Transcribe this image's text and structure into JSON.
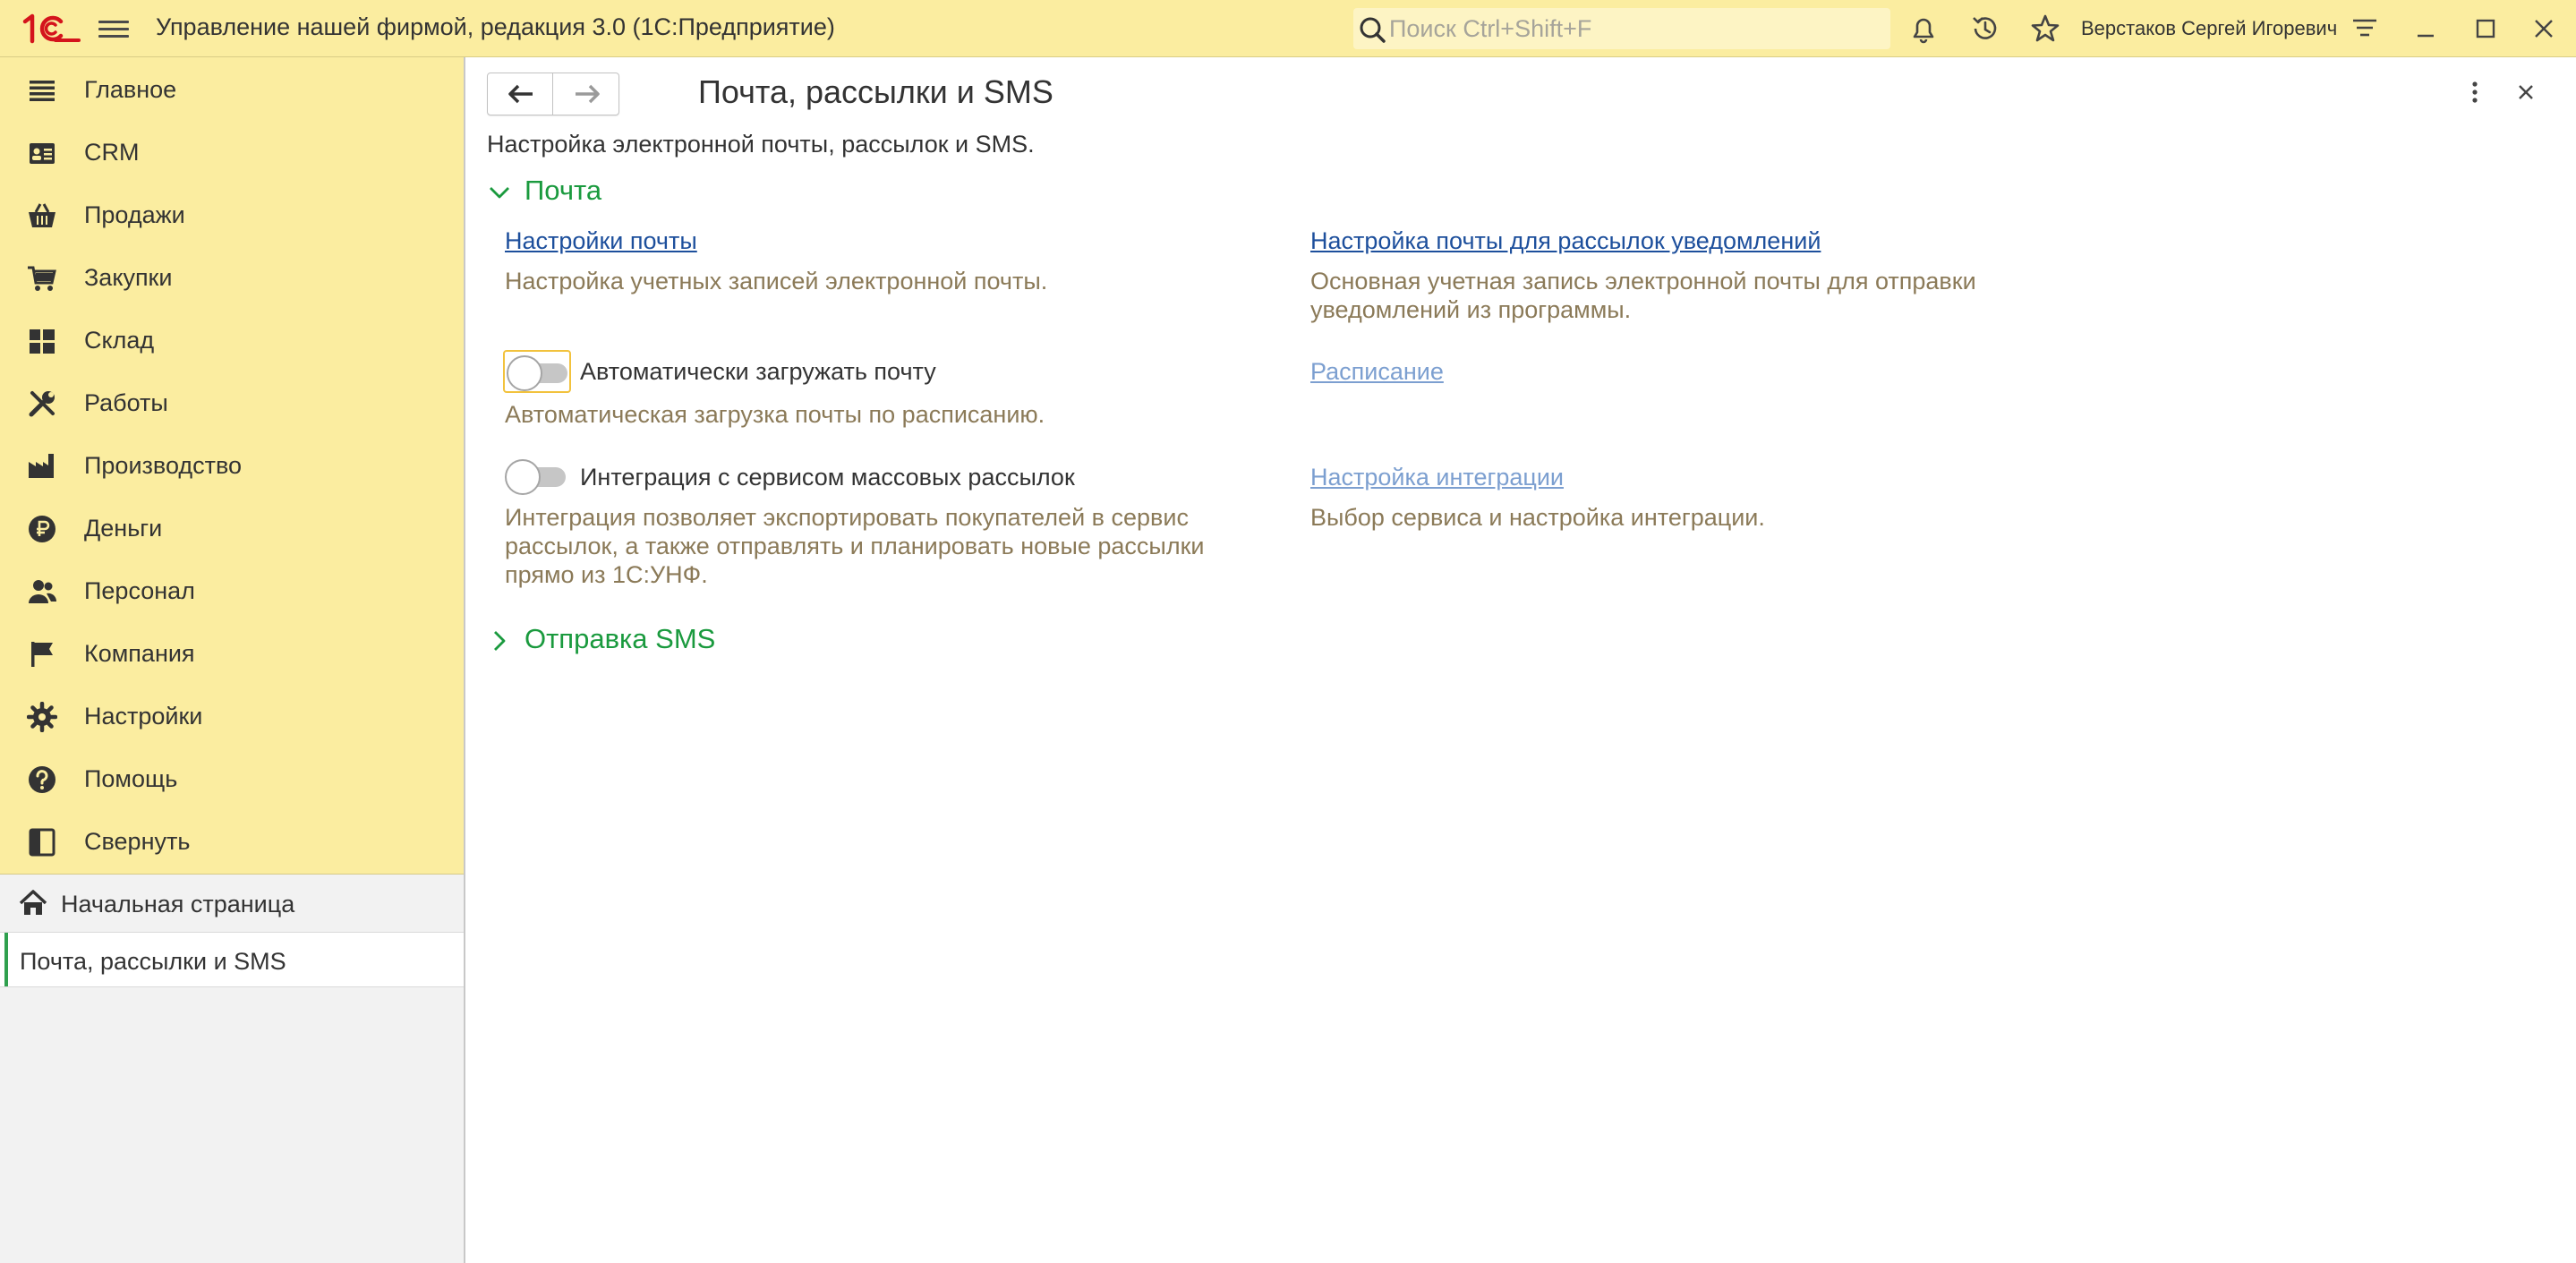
{
  "app": {
    "title": "Управление нашей фирмой, редакция 3.0  (1С:Предприятие)",
    "logo_icon": "1c-logo",
    "brand_color": "#d4141c"
  },
  "search": {
    "placeholder": "Поиск Ctrl+Shift+F"
  },
  "user": {
    "name": "Верстаков Сергей Игоревич"
  },
  "titlebar_icons": [
    "search-icon",
    "bell-icon",
    "history-icon",
    "star-icon",
    "settings-menu-icon",
    "minimize-icon",
    "maximize-icon",
    "close-icon"
  ],
  "sidebar": {
    "sections": [
      {
        "label": "Главное",
        "icon": "main-icon"
      },
      {
        "label": "CRM",
        "icon": "crm-icon"
      },
      {
        "label": "Продажи",
        "icon": "basket-icon"
      },
      {
        "label": "Закупки",
        "icon": "cart-icon"
      },
      {
        "label": "Склад",
        "icon": "warehouse-icon"
      },
      {
        "label": "Работы",
        "icon": "tools-icon"
      },
      {
        "label": "Производство",
        "icon": "factory-icon"
      },
      {
        "label": "Деньги",
        "icon": "ruble-icon"
      },
      {
        "label": "Персонал",
        "icon": "people-icon"
      },
      {
        "label": "Компания",
        "icon": "flag-icon"
      },
      {
        "label": "Настройки",
        "icon": "gear-icon"
      },
      {
        "label": "Помощь",
        "icon": "help-icon"
      },
      {
        "label": "Свернуть",
        "icon": "collapse-panel-icon"
      }
    ],
    "open_windows": [
      {
        "label": "Начальная страница",
        "icon": "home-icon"
      },
      {
        "label": "Почта, рассылки и SMS",
        "active": true
      }
    ]
  },
  "form": {
    "title": "Почта, рассылки и SMS",
    "description": "Настройка электронной почты, рассылок и SMS.",
    "groups": [
      {
        "title": "Почта",
        "expanded": true,
        "left": {
          "link": "Настройки почты",
          "link_hint": "Настройка учетных записей электронной почты.",
          "toggle1": {
            "label": "Автоматически загружать почту",
            "checked": false,
            "hint": "Автоматическая загрузка почты по расписанию."
          },
          "toggle2": {
            "label": "Интеграция с сервисом массовых рассылок",
            "checked": false,
            "hint_lines": [
              "Интеграция позволяет экспортировать покупателей в сервис",
              "рассылок, а также отправлять и планировать новые рассылки",
              "прямо из 1С:УНФ."
            ]
          }
        },
        "right": {
          "link1": "Настройка почты для рассылок уведомлений",
          "link1_hint_lines": [
            "Основная учетная запись электронной почты для отправки",
            "уведомлений из программы."
          ],
          "link2": "Расписание",
          "link3": "Настройка интеграции",
          "link3_hint": "Выбор сервиса и настройка интеграции."
        }
      },
      {
        "title": "Отправка SMS",
        "expanded": false
      }
    ]
  },
  "colors": {
    "titlebar_bg": "#fbeda0",
    "group_title": "#1a9a3e",
    "link": "#1d4f9c",
    "hint": "#8b7a58",
    "active_marker": "#2fa04e"
  }
}
